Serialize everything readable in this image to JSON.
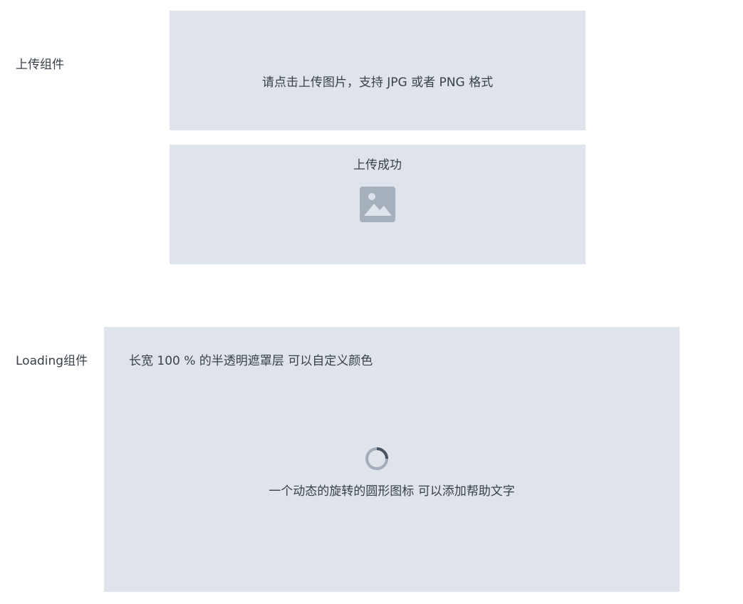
{
  "upload_section": {
    "label": "上传组件",
    "prompt_text": "请点击上传图片，支持 JPG 或者 PNG 格式",
    "success_text": "上传成功",
    "success_icon": "image-icon"
  },
  "loading_section": {
    "label": "Loading组件",
    "description": "长宽 100 % 的半透明遮罩层 可以自定义颜色",
    "spinner_icon": "spinner-icon",
    "help_text": "一个动态的旋转的圆形图标 可以添加帮助文字"
  },
  "colors": {
    "panel_background": "#dfe4ec",
    "icon_color": "#a5b0bc",
    "spinner_track": "#a3acb8",
    "spinner_arc": "#4a5360",
    "text": "#3a4049"
  }
}
